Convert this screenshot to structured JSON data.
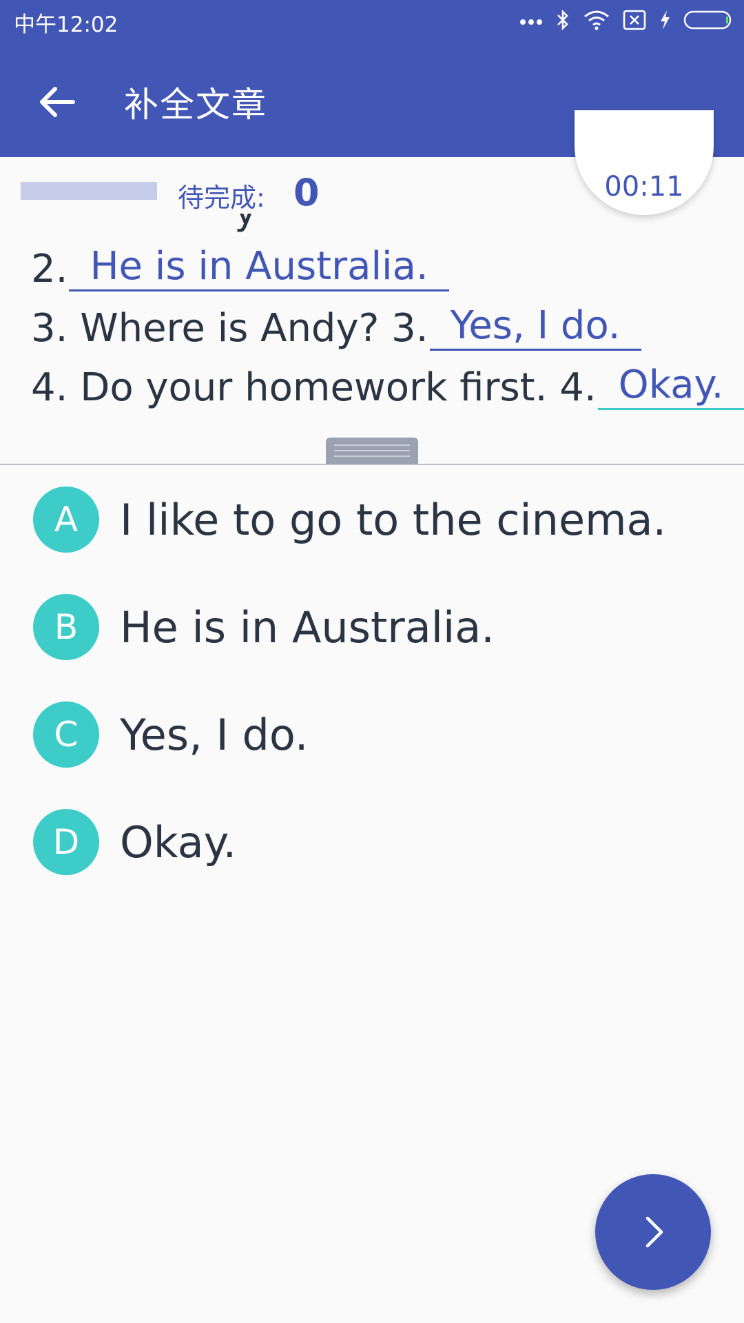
{
  "status_bar": {
    "time": "中午12:02",
    "icons": [
      "more-dots-icon",
      "bluetooth-icon",
      "wifi-icon",
      "sim-off-icon",
      "charging-icon",
      "battery-icon"
    ]
  },
  "app_bar": {
    "title": "补全文章",
    "back_icon": "arrow-left-icon"
  },
  "progress": {
    "pending_label": "待完成:",
    "pending_count": "0",
    "timer": "00:11"
  },
  "passage": {
    "lines": [
      {
        "prefix": "2.",
        "answer": "He is in Australia."
      },
      {
        "prefix": "3. Where is Andy? 3.",
        "answer": "Yes, I do."
      },
      {
        "prefix": "4. Do your homework first. 4.",
        "answer": "Okay."
      }
    ]
  },
  "options": [
    {
      "letter": "A",
      "text": "I like to go to the cinema."
    },
    {
      "letter": "B",
      "text": "He is in Australia."
    },
    {
      "letter": "C",
      "text": "Yes, I do."
    },
    {
      "letter": "D",
      "text": "Okay."
    }
  ],
  "fab": {
    "icon": "chevron-right-icon"
  },
  "colors": {
    "primary": "#4256b5",
    "accent": "#3dccc7",
    "text": "#2a3442",
    "progress_track": "#c6cdea"
  }
}
